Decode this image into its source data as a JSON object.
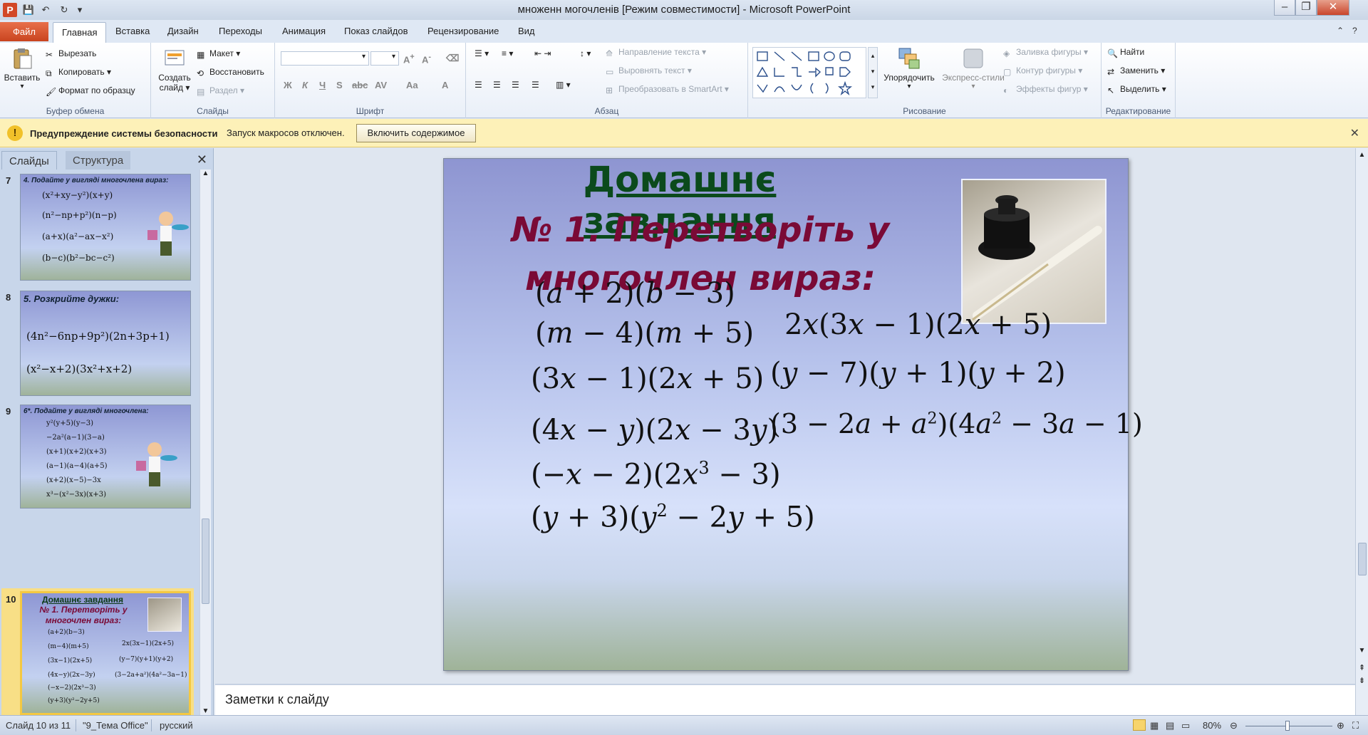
{
  "window": {
    "title": "множенн могочленів [Режим совместимости]  -  Microsoft PowerPoint"
  },
  "tabs": {
    "file": "Файл",
    "items": [
      "Главная",
      "Вставка",
      "Дизайн",
      "Переходы",
      "Анимация",
      "Показ слайдов",
      "Рецензирование",
      "Вид"
    ],
    "active": "Главная"
  },
  "ribbon": {
    "clipboard": {
      "paste": "Вставить",
      "cut": "Вырезать",
      "copy": "Копировать",
      "format_painter": "Формат по образцу",
      "label": "Буфер обмена"
    },
    "slides": {
      "new_slide_line1": "Создать",
      "new_slide_line2": "слайд",
      "layout": "Макет",
      "reset": "Восстановить",
      "section": "Раздел",
      "label": "Слайды"
    },
    "font": {
      "label": "Шрифт"
    },
    "paragraph": {
      "text_direction": "Направление текста",
      "align_text": "Выровнять текст",
      "convert_smartart": "Преобразовать в SmartArt",
      "label": "Абзац"
    },
    "drawing": {
      "arrange": "Упорядочить",
      "quick_styles": "Экспресс-стили",
      "shape_fill": "Заливка фигуры",
      "shape_outline": "Контур фигуры",
      "shape_effects": "Эффекты фигур",
      "label": "Рисование"
    },
    "editing": {
      "find": "Найти",
      "replace": "Заменить",
      "select": "Выделить",
      "label": "Редактирование"
    }
  },
  "security": {
    "title": "Предупреждение системы безопасности",
    "message": "Запуск макросов отключен.",
    "button": "Включить содержимое"
  },
  "left_pane": {
    "tab_slides": "Слайды",
    "tab_outline": "Структура",
    "thumbs": [
      {
        "number": "7",
        "heading": "4. Подайте у вигляді многочлена вираз:"
      },
      {
        "number": "8",
        "heading": "5. Розкрийте дужки:"
      },
      {
        "number": "9",
        "heading": "6*. Подайте у вигляді многочлена:"
      },
      {
        "number": "10",
        "heading1": "Домашнє завдання",
        "heading2": "№ 1. Перетворіть у многочлен вираз:"
      }
    ]
  },
  "slide": {
    "title": "Домашнє завдання",
    "subtitle_line1": "№ 1. Перетворіть у",
    "subtitle_line2": "многочлен вираз:"
  },
  "notes": {
    "placeholder": "Заметки к слайду"
  },
  "status": {
    "slide_info": "Слайд 10 из 11",
    "theme": "\"9_Тема Office\"",
    "language": "русский",
    "zoom": "80%"
  }
}
